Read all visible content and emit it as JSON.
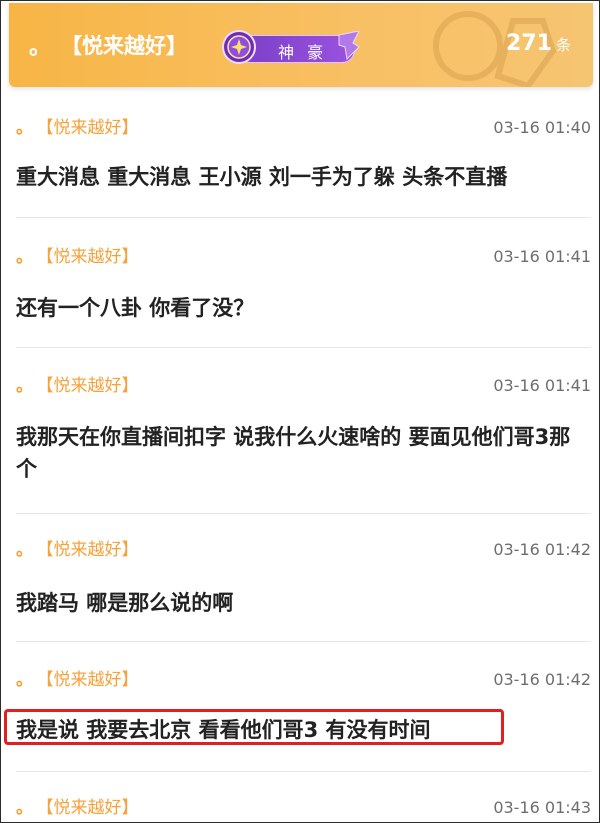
{
  "header": {
    "dot": "。",
    "username": "【悦来越好】",
    "rank_label": "神 豪",
    "count": "271",
    "count_unit": "条"
  },
  "messages": [
    {
      "dot": "。",
      "sender": "【悦来越好】",
      "time": "03-16 01:40",
      "text": "重大消息 重大消息 王小源 刘一手为了躲 头条不直播"
    },
    {
      "dot": "。",
      "sender": "【悦来越好】",
      "time": "03-16 01:41",
      "text": "还有一个八卦 你看了没？"
    },
    {
      "dot": "。",
      "sender": "【悦来越好】",
      "time": "03-16 01:41",
      "text": "我那天在你直播间扣字 说我什么火速啥的 要面见他们哥3那个"
    },
    {
      "dot": "。",
      "sender": "【悦来越好】",
      "time": "03-16 01:42",
      "text": "我踏马 哪是那么说的啊"
    },
    {
      "dot": "。",
      "sender": "【悦来越好】",
      "time": "03-16 01:42",
      "text": "我是说 我要去北京 看看他们哥3 有没有时间"
    },
    {
      "dot": "。",
      "sender": "【悦来越好】",
      "time": "03-16 01:43",
      "text": ""
    }
  ],
  "colors": {
    "header_bg": "#f7b545",
    "sender": "#f6a23a",
    "highlight_border": "#e02020",
    "rank_pill": "#8a48d6"
  }
}
